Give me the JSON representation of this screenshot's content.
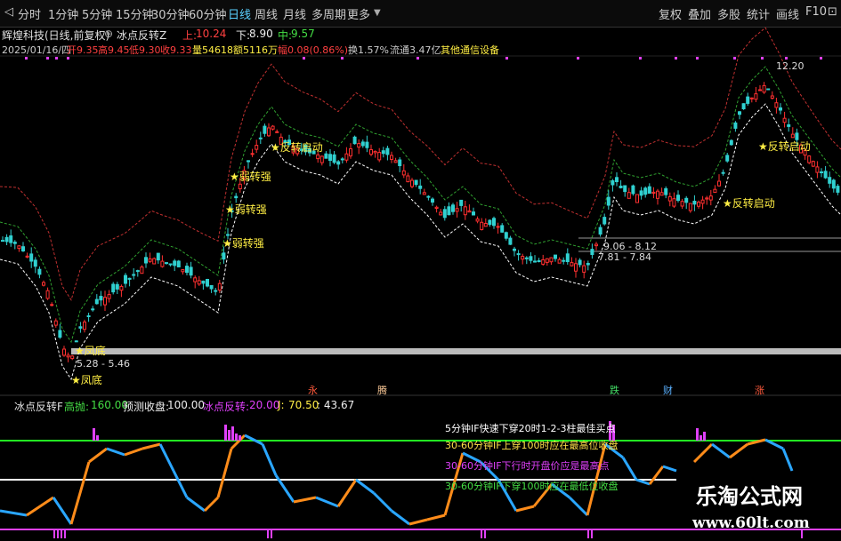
{
  "toolbar": {
    "left_items": [
      {
        "label": "分时"
      },
      {
        "label": "1分钟"
      },
      {
        "label": "5分钟"
      },
      {
        "label": "15分钟"
      },
      {
        "label": "30分钟"
      },
      {
        "label": "60分钟"
      },
      {
        "label": "日线",
        "active": true
      },
      {
        "label": "周线"
      },
      {
        "label": "月线"
      },
      {
        "label": "多周期"
      },
      {
        "label": "更多"
      }
    ],
    "right_items": [
      {
        "label": "复权"
      },
      {
        "label": "叠加"
      },
      {
        "label": "多股"
      },
      {
        "label": "统计"
      },
      {
        "label": "画线"
      },
      {
        "label": "F10"
      }
    ]
  },
  "stock": {
    "name": "辉煌科技(日线,前复权)",
    "indicator": "冰点反转Z",
    "up_label": "上:",
    "up_value": "10.24",
    "down_label": "下:",
    "down_value": "8.90",
    "mid_label": "中:",
    "mid_value": "9.57"
  },
  "info": {
    "date": "2025/01/16/四",
    "open": "开9.35",
    "high": "高9.45",
    "low": "低9.30",
    "close": "收9.33",
    "volume": "量54618",
    "amount": "额5116万",
    "change": "幅0.08(0.86%)",
    "turnover": "换1.57%",
    "float": "流通3.47亿",
    "sector": "其他通信设备"
  },
  "price_annotations": [
    {
      "text": "12.20"
    },
    {
      "text": "9.06 - 8.12"
    },
    {
      "text": "7.81 - 7.84"
    },
    {
      "text": "5.28 - 5.46"
    }
  ],
  "signals": [
    {
      "text": "凤底"
    },
    {
      "text": "凤底"
    },
    {
      "text": "弱转强"
    },
    {
      "text": "弱转强"
    },
    {
      "text": "弱转强"
    },
    {
      "text": "反转启动"
    },
    {
      "text": "反转启动"
    },
    {
      "text": "反转启动"
    }
  ],
  "markers": [
    {
      "text": "永",
      "color": "#ff5a3c"
    },
    {
      "text": "腾",
      "color": "#ffcc99"
    },
    {
      "text": "跌",
      "color": "#44dd66"
    },
    {
      "text": "财",
      "color": "#5ab0ff"
    },
    {
      "text": "涨",
      "color": "#ff5a3c"
    }
  ],
  "sub": {
    "name": "冰点反转F",
    "high_label": "高抛:",
    "high_value": "160.00",
    "predict_label": "预测收盘:",
    "predict_value": "100.00",
    "ice_label": "冰点反转:",
    "ice_value": "20.00",
    "j_label": "J:",
    "j_value": "70.50",
    "extra_value": ": 43.67"
  },
  "notes": [
    {
      "text": "5分钟IF快速下穿20时1-2-3柱最佳买点",
      "color": "#ffffff"
    },
    {
      "text": "30-60分钟IF上穿100时应在最高位收盘",
      "color": "#ffe04a"
    },
    {
      "text": "30-60分钟IF下行时开盘价应是最高点",
      "color": "#e040fb"
    },
    {
      "text": "30-60分钟IF下穿100时应在最低位收盘",
      "color": "#44dd44"
    }
  ],
  "watermark": {
    "title": "乐淘公式网",
    "url": "www.60lt.com"
  },
  "colors": {
    "up": "#ff3030",
    "down": "#30d0d0",
    "accent": "#5ad0ff",
    "upper_band": "#c03030",
    "mid_band": "#30a030",
    "lower_band": "#ffffff"
  }
}
